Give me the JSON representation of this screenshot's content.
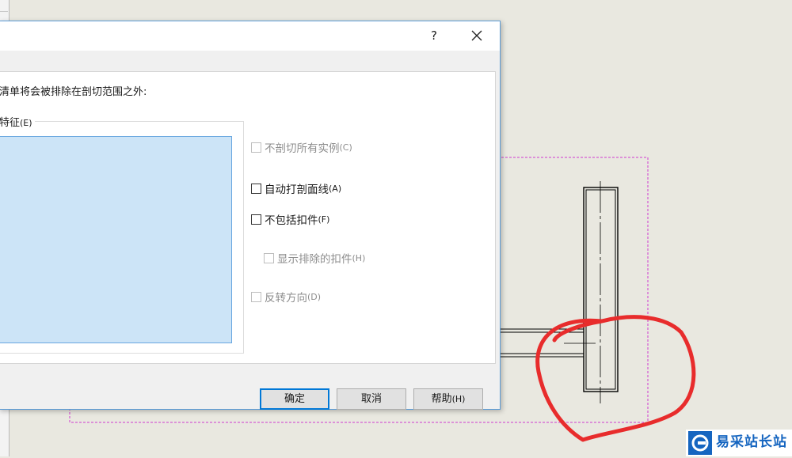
{
  "dialog": {
    "help_label": "?",
    "close_label": "✕",
    "instruction": "清单将会被排除在剖切范围之外:",
    "group_label": "特征",
    "group_accel": "(E)"
  },
  "options": {
    "no_section_all_instances": {
      "label": "不剖切所有实例",
      "accel": "(C)",
      "checked": false,
      "enabled": false
    },
    "auto_hatching": {
      "label": "自动打剖面线",
      "accel": "(A)",
      "checked": false,
      "enabled": true
    },
    "exclude_fasteners": {
      "label": "不包括扣件",
      "accel": "(F)",
      "checked": false,
      "enabled": true
    },
    "show_excluded_fasteners": {
      "label": "显示排除的扣件",
      "accel": "(H)",
      "checked": false,
      "enabled": false
    },
    "reverse_direction": {
      "label": "反转方向",
      "accel": "(D)",
      "checked": false,
      "enabled": false
    }
  },
  "buttons": {
    "ok": "确定",
    "cancel": "取消",
    "help": "帮助",
    "help_accel": "(H)"
  },
  "watermark": {
    "text": "易采站长站"
  },
  "colors": {
    "accent": "#0078d7",
    "selection": "#cce4f7",
    "markup_red": "#e82c2c",
    "boundary_magenta": "#d03ad0"
  }
}
